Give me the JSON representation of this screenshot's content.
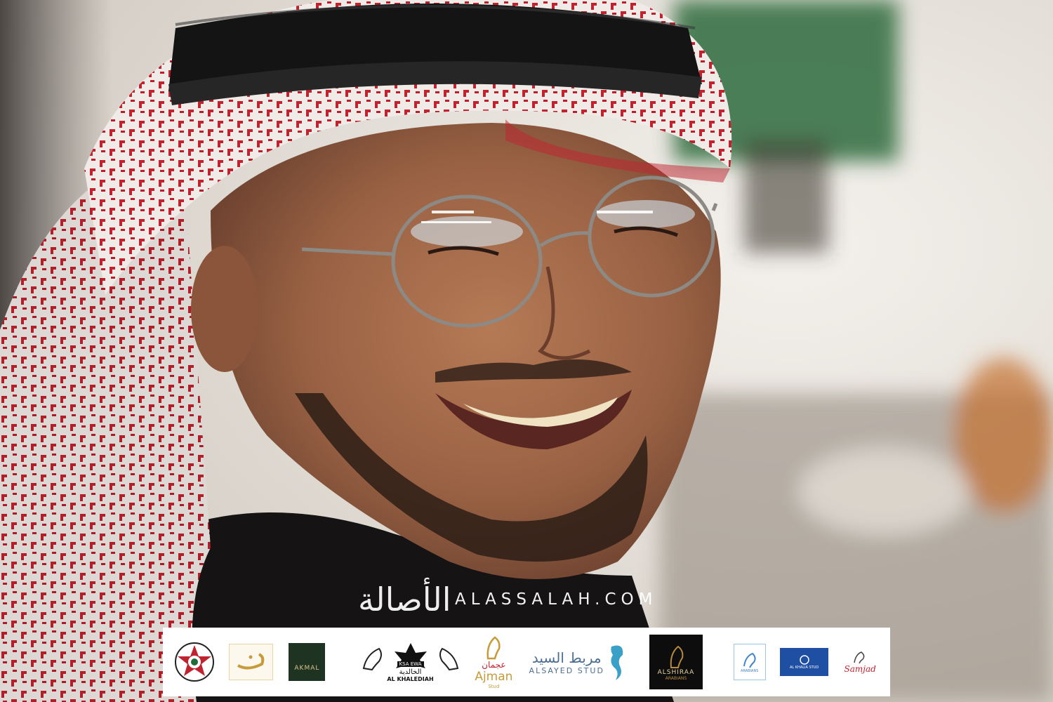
{
  "watermark": {
    "arabic": "الأصالة",
    "latin": "ALASSALAH.COM"
  },
  "sponsors": {
    "akmal": "AKMAL",
    "ksa_ewa": "KSA EWA",
    "khalediah_ar": "الخالدية",
    "khalediah_en": "AL KHALEDIAH",
    "ajman_ar": "عجمان",
    "ajman_en": "Ajman",
    "ajman_sub": "Stud",
    "alsayed_ar": "مربط السيد",
    "alsayed_en": "ALSAYED STUD",
    "alshiraa": "ALSHIRAA",
    "alshiraa_sub": "ARABIANS",
    "arabians": "ARABIANS",
    "alkhalia": "AL KHALIA STUD",
    "samjad": "Samjad"
  },
  "colors": {
    "keffiyeh_red": "#c1222f",
    "agal_black": "#141414",
    "bar_bg": "#ffffff"
  }
}
